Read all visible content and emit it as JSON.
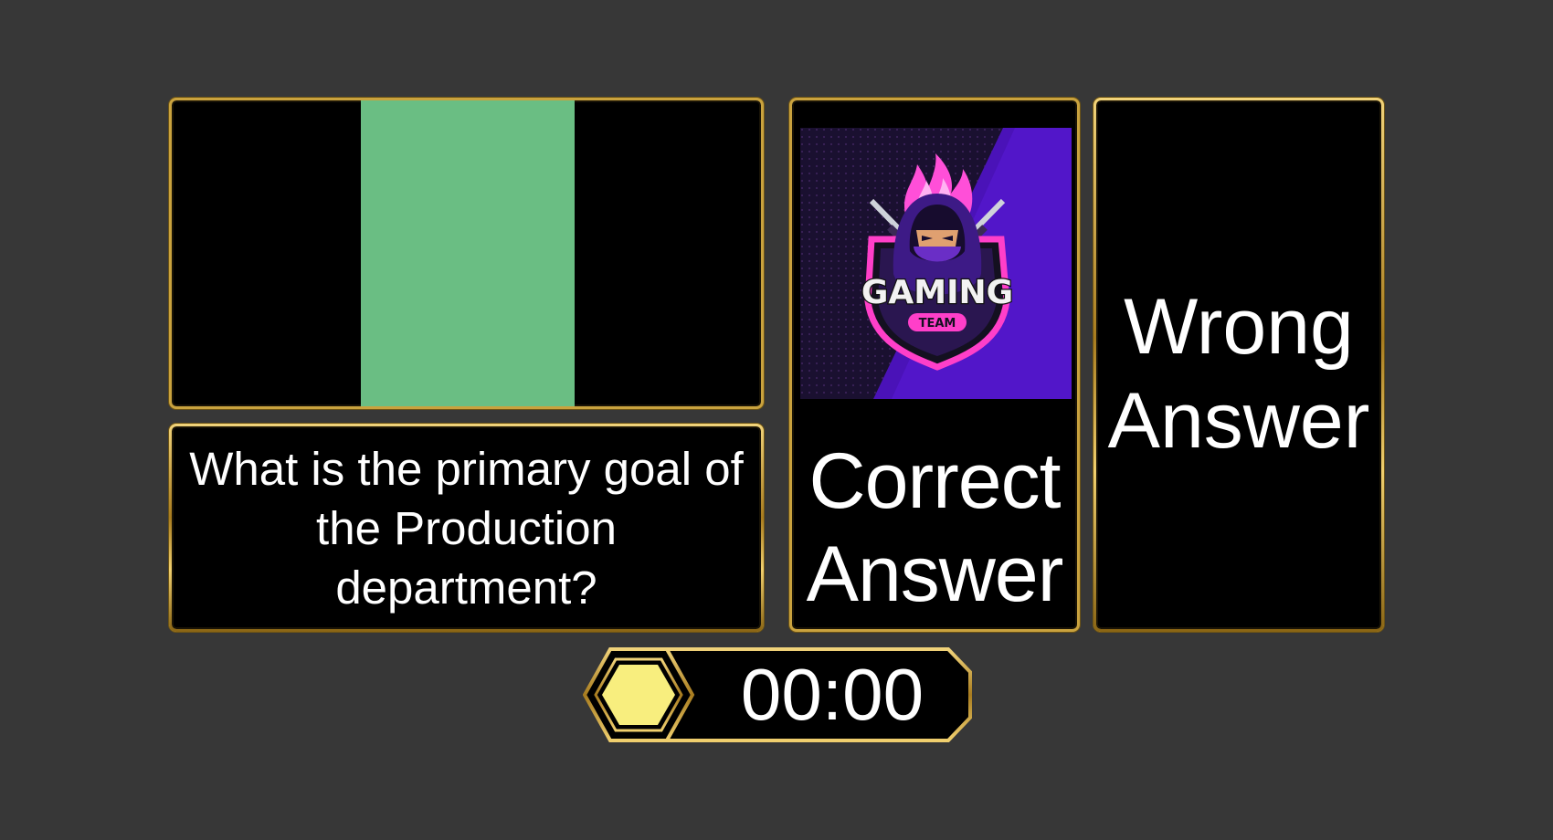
{
  "question": {
    "text": "What is the primary goal of the Production department?"
  },
  "media": {
    "swatch_color": "#6abe83"
  },
  "answers": [
    {
      "label": "Correct Answer",
      "image": "gaming-team-logo",
      "logo_text": "GAMING",
      "logo_subtext": "TEAM"
    },
    {
      "label": "Wrong Answer"
    }
  ],
  "timer": {
    "value": "00:00",
    "hex_color": "#f8ee7e"
  },
  "colors": {
    "background": "#373737",
    "panel": "#000000",
    "gold_border": "#c9a23e"
  }
}
